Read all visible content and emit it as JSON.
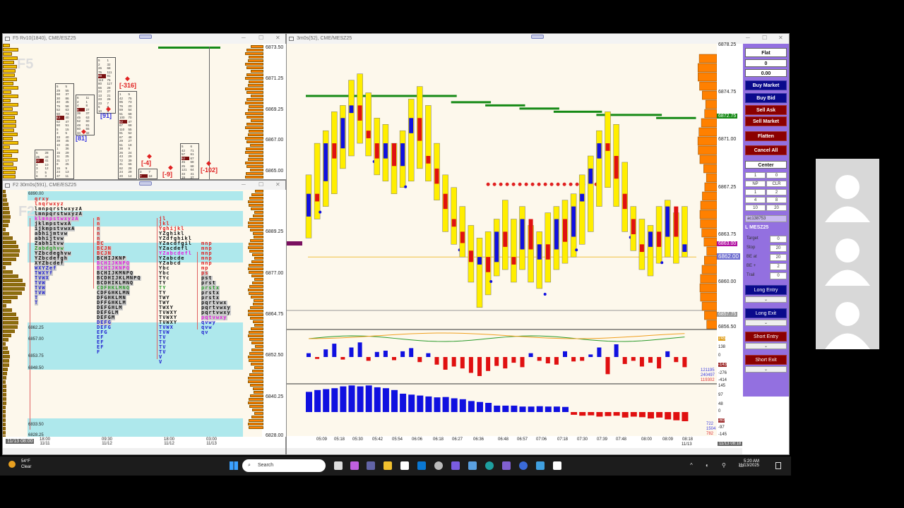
{
  "left_top_window": {
    "title": "F5 Rv10(1840), CME/ESZ25",
    "watermark": "F5",
    "price_axis": [
      "6873.50",
      "6871.25",
      "6869.25",
      "6867.00",
      "6865.00"
    ],
    "footprint": [
      {
        "rows": [
          "5 28",
          "25 43",
          "22 41",
          "4 10",
          "3 12",
          "7 5",
          "6 3"
        ],
        "label": ""
      },
      {
        "rows": [
          "5 5",
          "29 55",
          "58 37",
          "30 86",
          "40 45",
          "75 58",
          "52 63",
          "50 73",
          "43 40",
          "62 47",
          "50 51",
          "5 15",
          "3 5",
          "33 40",
          "39 45",
          "10 26",
          "1 36",
          "15 29",
          "11 25",
          "31 17",
          "9 25",
          "15 9",
          "24 13",
          "37 11",
          "24 6"
        ],
        "label": ""
      },
      {
        "rows": [
          "6 11",
          "2 1",
          "4 8",
          "8 27",
          "39 37",
          "45 63",
          "52 60",
          "48 81",
          "60 55",
          "34 32"
        ],
        "label": "[81]"
      },
      {
        "rows": [
          "5 1",
          "2 32",
          "26 68",
          "75 111",
          "89 91",
          "113 75",
          "80 117",
          "66 28",
          "24 27",
          "13 21",
          "23 26",
          "23 7",
          "5 8",
          "10 5"
        ],
        "label": "[91]"
      },
      {
        "rows": [
          "1 5",
          "42 75",
          "95 73",
          "76 20",
          "59 54",
          "51 68",
          "100 70",
          "52 47",
          "67 68",
          "110 55",
          "91 52",
          "67 48",
          "29 27",
          "51 18",
          "38 9",
          "26 24",
          "43 29",
          "72 39",
          "41 66",
          "62 28",
          "24 29",
          "20 14",
          "35 16"
        ],
        "label": "[-316]"
      },
      {
        "rows": [
          "3 7",
          "7 18",
          "40 34"
        ],
        "label": "[-4]"
      },
      {
        "rows": [],
        "label": "[-9]"
      },
      {
        "rows": [
          "5 6",
          "42 71",
          "57 61",
          "52 67",
          "45 68",
          "25 68",
          "121 64",
          "33 41",
          "19 37",
          "17 9"
        ],
        "label": "[-102]"
      }
    ]
  },
  "left_bottom_window": {
    "title": "F2 30m0s(591), CME/ESZ25",
    "watermark": "F2",
    "left_prices": [
      "6890.00",
      "6862.25",
      "6857.00",
      "6853.75",
      "6848.50",
      "6833.50",
      "6828.25"
    ],
    "price_axis": [
      "6889.25",
      "6877.00",
      "6864.75",
      "6852.50",
      "6840.25",
      "6828.00"
    ],
    "time_axis": [
      {
        "t": "18:00",
        "d": "11/11"
      },
      {
        "t": "09:30",
        "d": "11/12"
      },
      {
        "t": "18:00",
        "d": "11/12"
      },
      {
        "t": "03:00",
        "d": "11/13"
      }
    ],
    "cursor_time": "11/13 08:00",
    "tpo_columns": [
      {
        "rows": [
          "qrxy",
          "lnqrwxyz",
          "lmnpqrstwxyzA",
          "lmnpqrstwxyzA",
          "klmnpstwxyzA",
          "jklmpstwxA",
          "ijkmpstvwxA",
          "abhijmtvw",
          "abhijtvw",
          "Zabhitvw",
          "Zabdghvw",
          "YZbcdeghvw",
          "YZbcdefgh",
          "XYZbcdef",
          "WXYZef",
          "TWXYf",
          "TVWX",
          "TVW",
          "TVW",
          "TVW",
          "T",
          "T"
        ]
      },
      {
        "rows": [
          "",
          "",
          "",
          "",
          "n",
          "n",
          "n",
          "n",
          "n",
          "BC",
          "BCJN",
          "BCJN",
          "BCHIJKNP",
          "BCHIJKNPQ",
          "BCHIJKNPQ",
          "BCHIJKMNPQ",
          "BCDHIJKLMNPQ",
          "BCDHIKLMNQ",
          "CDFHKLMNQ",
          "CDFGHKLMN",
          "DFGHKLMN",
          "DFFGHKLM",
          "DEFGHLM",
          "DEFGLM",
          "DEFGM",
          "DEFG",
          "DEFG",
          "EFG",
          "EF",
          "EF",
          "EF",
          "F"
        ]
      },
      {
        "rows": [
          "",
          "",
          "",
          "",
          "jl",
          "jkl",
          "Yghijkl",
          "YZghikl",
          "YZdfghikl",
          "YZacdfgil",
          "YZacdefl",
          "YZabcdefl",
          "YZabcde",
          "YZabcd",
          "Ybc",
          "Ybc",
          "TYc",
          "TY",
          "TY",
          "TY",
          "TWY",
          "TWY",
          "TWXY",
          "TVWXY",
          "TVWXY",
          "TVWXY",
          "TVWX",
          "TVW",
          "TV",
          "TV",
          "TV",
          "TV",
          "V",
          "V"
        ]
      },
      {
        "rows": [
          "",
          "",
          "",
          "",
          "",
          "",
          "",
          "",
          "",
          "mnp",
          "mnp",
          "mnp",
          "mnp",
          "mnp",
          "mp",
          "ps",
          "pst",
          "prst",
          "prstx",
          "prstx",
          "prstx",
          "pqrtvwx",
          "pqrtvwxy",
          "pqrtvwxy",
          "pqtvwxy",
          "qvwy",
          "qvw",
          "qv"
        ]
      }
    ]
  },
  "main_window": {
    "title": "3m0s(52), CME/MESZ25",
    "price_axis": [
      "6878.25",
      "6874.75",
      "6871.00",
      "6867.25",
      "6863.75",
      "6860.00",
      "6856.50"
    ],
    "tags": {
      "green": "6872.75",
      "magenta": "6863.00",
      "last": "6862.00",
      "gray": "6857.75"
    },
    "delta_axis": [
      "745",
      "138",
      "0",
      "-143",
      "-276",
      "-414"
    ],
    "delta_stats": [
      "121195",
      "240497",
      "119302"
    ],
    "volume_axis": [
      "145",
      "97",
      "48",
      "0",
      "-60",
      "-97",
      "-145"
    ],
    "volume_stats": [
      "722",
      "1504",
      "782"
    ],
    "time_axis": [
      "05:09",
      "05:18",
      "05:30",
      "05:42",
      "05:54",
      "06:06",
      "06:18",
      "06:27",
      "06:36",
      "06:48",
      "06:57",
      "07:06",
      "07:18",
      "07:30",
      "07:39",
      "07:48",
      "08:00",
      "08:09",
      "08:18"
    ],
    "date_label": "11/13",
    "cursor_time": "11/13 08:18"
  },
  "chart_data": {
    "type": "candlestick",
    "title": "3m0s(52), CME/MESZ25",
    "ylim": [
      6856.5,
      6878.25
    ],
    "bars": [
      [
        6864,
        6868.5,
        6863.5,
        6867
      ],
      [
        6867,
        6871,
        6865,
        6866
      ],
      [
        6866,
        6872,
        6866,
        6871
      ],
      [
        6871,
        6873.5,
        6867,
        6869
      ],
      [
        6869,
        6874,
        6869,
        6873
      ],
      [
        6873,
        6876,
        6870,
        6874
      ],
      [
        6874,
        6876.5,
        6871,
        6872
      ],
      [
        6872,
        6875,
        6870,
        6871
      ],
      [
        6871,
        6873,
        6868.5,
        6869
      ],
      [
        6869,
        6872.5,
        6868,
        6871
      ],
      [
        6871,
        6871,
        6867,
        6868
      ],
      [
        6868,
        6872,
        6867.5,
        6871
      ],
      [
        6871,
        6874.5,
        6868,
        6873
      ],
      [
        6873,
        6875.5,
        6869,
        6870
      ],
      [
        6870,
        6874,
        6868,
        6869
      ],
      [
        6869,
        6871,
        6866.5,
        6867
      ],
      [
        6867,
        6868.5,
        6864,
        6865
      ],
      [
        6865,
        6867.5,
        6863,
        6864
      ],
      [
        6864,
        6866,
        6862,
        6862.5
      ],
      [
        6862.5,
        6864.5,
        6860,
        6861
      ],
      [
        6861,
        6863.5,
        6858,
        6862
      ],
      [
        6862,
        6864,
        6859,
        6860
      ],
      [
        6860,
        6865,
        6860.5,
        6864
      ],
      [
        6864,
        6866.5,
        6861,
        6862
      ],
      [
        6862,
        6865,
        6860,
        6861
      ],
      [
        6861,
        6866,
        6861,
        6865
      ],
      [
        6865,
        6864.5,
        6860,
        6861
      ],
      [
        6861,
        6864,
        6859.5,
        6863
      ],
      [
        6863,
        6865.5,
        6860,
        6861
      ],
      [
        6861,
        6866,
        6861,
        6865
      ],
      [
        6865,
        6866.5,
        6861.5,
        6862
      ],
      [
        6862,
        6867,
        6862,
        6866
      ],
      [
        6866,
        6868.5,
        6863,
        6867
      ],
      [
        6867,
        6870,
        6864,
        6869
      ],
      [
        6869,
        6872,
        6866,
        6871
      ],
      [
        6871,
        6873.5,
        6867.5,
        6870
      ],
      [
        6870,
        6872.5,
        6866,
        6867
      ],
      [
        6867,
        6869.5,
        6864,
        6865
      ],
      [
        6865,
        6866,
        6862.5,
        6863
      ],
      [
        6863,
        6865,
        6861,
        6862
      ],
      [
        6862,
        6864.5,
        6860.5,
        6864
      ],
      [
        6864,
        6866,
        6861.5,
        6862
      ],
      [
        6862,
        6866.5,
        6862,
        6866
      ],
      [
        6866,
        6865.5,
        6861.5,
        6862
      ],
      [
        6862,
        6866,
        6862,
        6863
      ]
    ],
    "levels": [
      {
        "from": 0,
        "to": 17,
        "price": 6874.75
      },
      {
        "from": 17,
        "to": 21,
        "price": 6874.25
      },
      {
        "from": 21,
        "to": 25,
        "price": 6874
      },
      {
        "from": 25,
        "to": 29,
        "price": 6873.75
      },
      {
        "from": 29,
        "to": 34,
        "price": 6873.5
      },
      {
        "from": 34,
        "to": 41,
        "price": 6873.25
      },
      {
        "from": 41,
        "to": 45,
        "price": 6873
      }
    ],
    "red_level": {
      "from": 21,
      "to": 34,
      "price": 6867.75
    },
    "delta": [
      60,
      -30,
      120,
      210,
      -40,
      150,
      230,
      -60,
      80,
      100,
      -50,
      90,
      140,
      -80,
      60,
      -120,
      -200,
      -150,
      -180,
      -250,
      -300,
      -220,
      -140,
      -180,
      -90,
      -160,
      60,
      -60,
      -100,
      -120,
      90,
      -70,
      -60,
      40,
      150,
      -270,
      200,
      -110,
      -60,
      -150,
      -90,
      -180,
      90,
      -80,
      -160
    ],
    "volume": [
      110,
      120,
      125,
      130,
      140,
      145,
      140,
      145,
      135,
      130,
      120,
      100,
      95,
      90,
      85,
      80,
      82,
      75,
      70,
      60,
      55,
      50,
      35,
      35,
      35,
      30,
      30,
      32,
      30,
      30,
      28,
      -15,
      -20,
      -18,
      -25,
      -22,
      -20,
      -30,
      -25,
      -28,
      -35,
      -30,
      -40,
      -45,
      -50
    ]
  },
  "order_panel": {
    "position": "Flat",
    "qty": "0",
    "pnl": "0.00",
    "buy_market": "Buy Market",
    "buy_bid": "Buy Bid",
    "sell_ask": "Sell Ask",
    "sell_market": "Sell Market",
    "flatten": "Flatten",
    "cancel_all": "Cancel All",
    "center": "Center",
    "qty_input": "1",
    "qty_right": "0",
    "np": "NP",
    "clr": "CLR",
    "qty_presets": [
      "1",
      "2",
      "4",
      "8",
      "10",
      "20"
    ],
    "account": "ac138753",
    "instrument": "L MESZ25",
    "fields": [
      {
        "label": "Target",
        "value": "0"
      },
      {
        "label": "Stop",
        "value": "20"
      },
      {
        "label": "BE at",
        "value": "20"
      },
      {
        "label": "BE +",
        "value": "2"
      },
      {
        "label": "Trail",
        "value": "0"
      }
    ],
    "long_entry": "Long Entry",
    "long_exit": "Long Exit",
    "short_entry": "Short Entry",
    "short_exit": "Short Exit",
    "colors": {
      "panel": "#9370e0",
      "buy": "#0a0a8c",
      "sell": "#8b0000"
    }
  },
  "taskbar": {
    "temp": "54°F",
    "weather": "Clear",
    "search": "Search",
    "time": "5:20 AM",
    "date": "11/13/2025"
  }
}
